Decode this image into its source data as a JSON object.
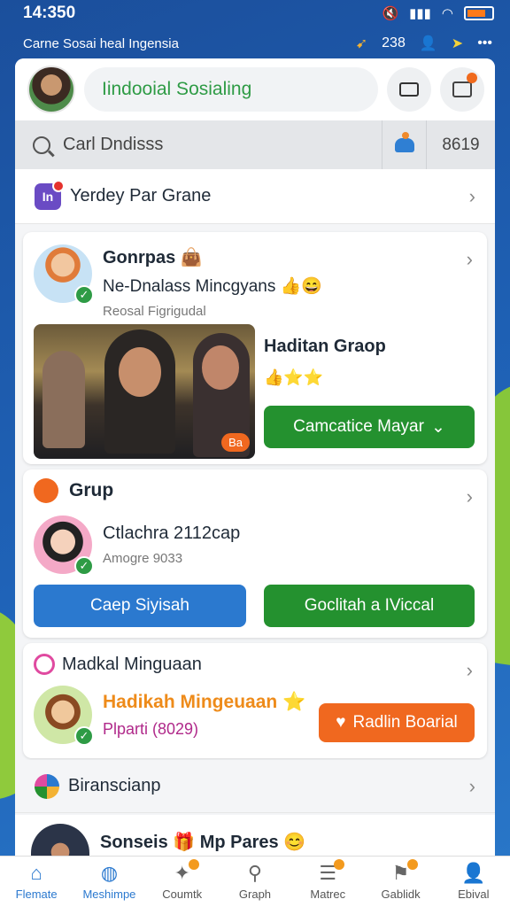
{
  "status": {
    "time": "14:350",
    "icons": [
      "mute-icon",
      "signal-icon",
      "wifi-icon",
      "battery-icon"
    ]
  },
  "appbar": {
    "title": "Carne Sosai heal Ingensia",
    "count": "238",
    "icons": [
      "rocket-icon",
      "profile-icon",
      "send-icon",
      "more-icon"
    ]
  },
  "header": {
    "brand": "Iindooial Sosialing"
  },
  "search": {
    "placeholder": "Carl Dndisss",
    "count": "8619"
  },
  "shortcut": {
    "label": "Yerdey Par Grane",
    "badge": "In"
  },
  "card1": {
    "title": "Gonrpas",
    "emoji": "👜",
    "subtitle": "Ne-Dnalass Mincgyans",
    "subtitle_emoji": "👍😄",
    "meta": "Reosal Figrigudal",
    "group_title": "Haditan Graop",
    "rating": "👍⭐⭐",
    "photo_tag": "Ba",
    "action": "Camcatice Mayar"
  },
  "card2": {
    "title": "Grup",
    "name": "Ctlachra 2112cap",
    "meta": "Amogre 9033",
    "button_left": "Caep Siyisah",
    "button_right": "Goclitah a IViccal"
  },
  "card3": {
    "title": "Madkal Minguaan",
    "highlight": "Hadikah Mingeuaan",
    "highlight_emoji": "⭐",
    "sub": "Plparti (8029)",
    "button": "Radlin Boarial"
  },
  "row4": {
    "label": "Biranscianp"
  },
  "row5": {
    "label": "Sonseis",
    "label2": "Mp Pares",
    "emoji": "🎁",
    "emoji2": "😊"
  },
  "tabs": [
    {
      "label": "Flemate",
      "icon": "home-icon"
    },
    {
      "label": "Meshimpe",
      "icon": "circle-icon"
    },
    {
      "label": "Coumtk",
      "icon": "users-icon"
    },
    {
      "label": "Graph",
      "icon": "search-icon"
    },
    {
      "label": "Matrec",
      "icon": "news-icon"
    },
    {
      "label": "Gablidk",
      "icon": "group-icon"
    },
    {
      "label": "Ebival",
      "icon": "person-icon"
    }
  ],
  "colors": {
    "accent_blue": "#2b79cf",
    "accent_green": "#24912f",
    "accent_orange": "#f0681f",
    "brand_green": "#2e9b45"
  }
}
